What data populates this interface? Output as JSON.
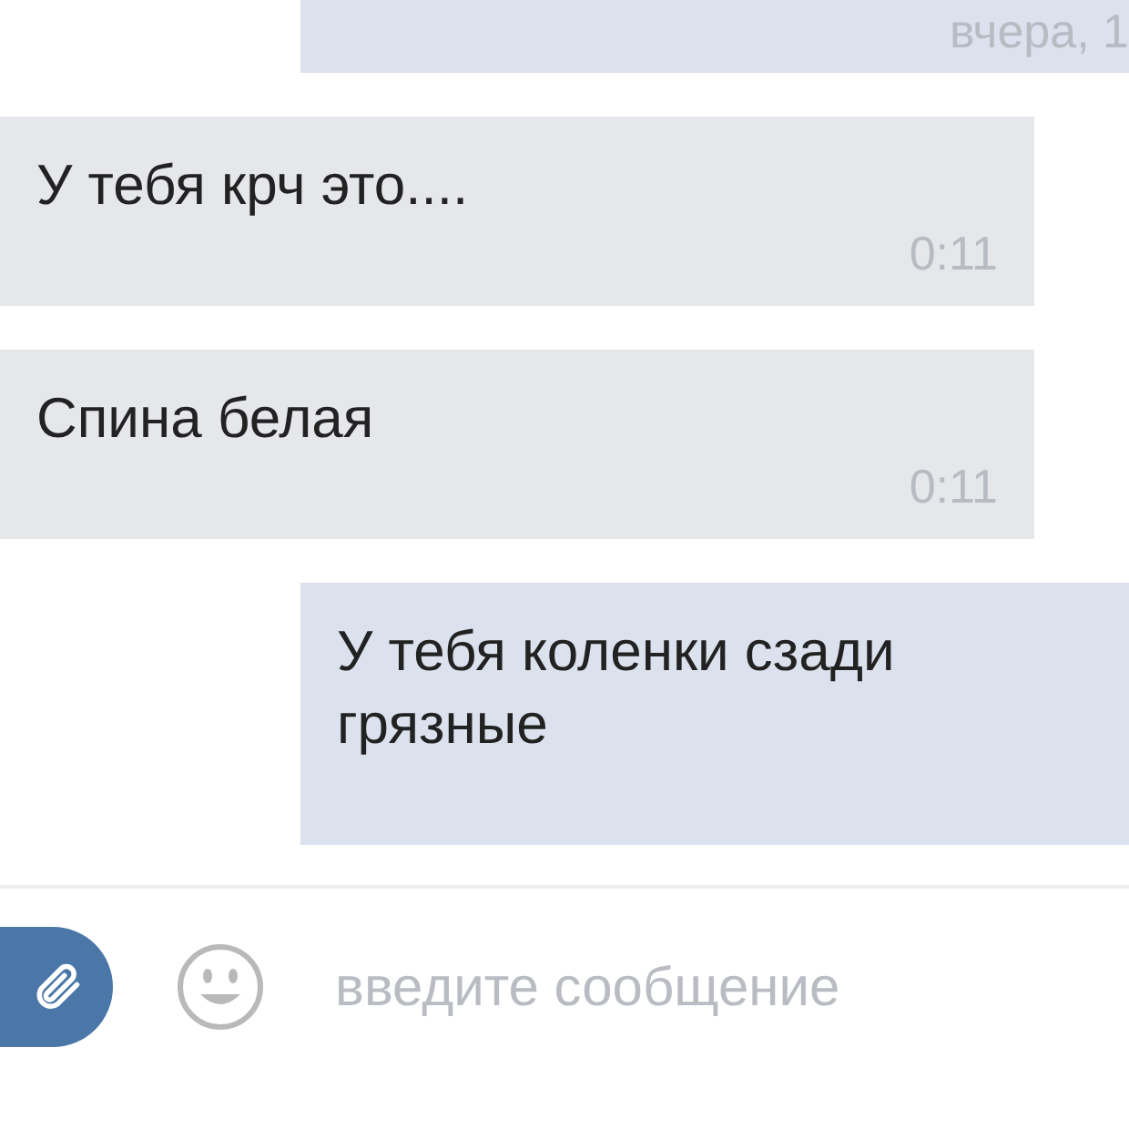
{
  "messages": [
    {
      "kind": "out",
      "time": "вчера, 1"
    },
    {
      "kind": "in",
      "text": "У тебя крч это....",
      "time": "0:11"
    },
    {
      "kind": "in",
      "text": "Спина белая",
      "time": "0:11"
    },
    {
      "kind": "out",
      "text": "У тебя коленки сзади грязные"
    }
  ],
  "composer": {
    "placeholder": "введите сообщение"
  }
}
